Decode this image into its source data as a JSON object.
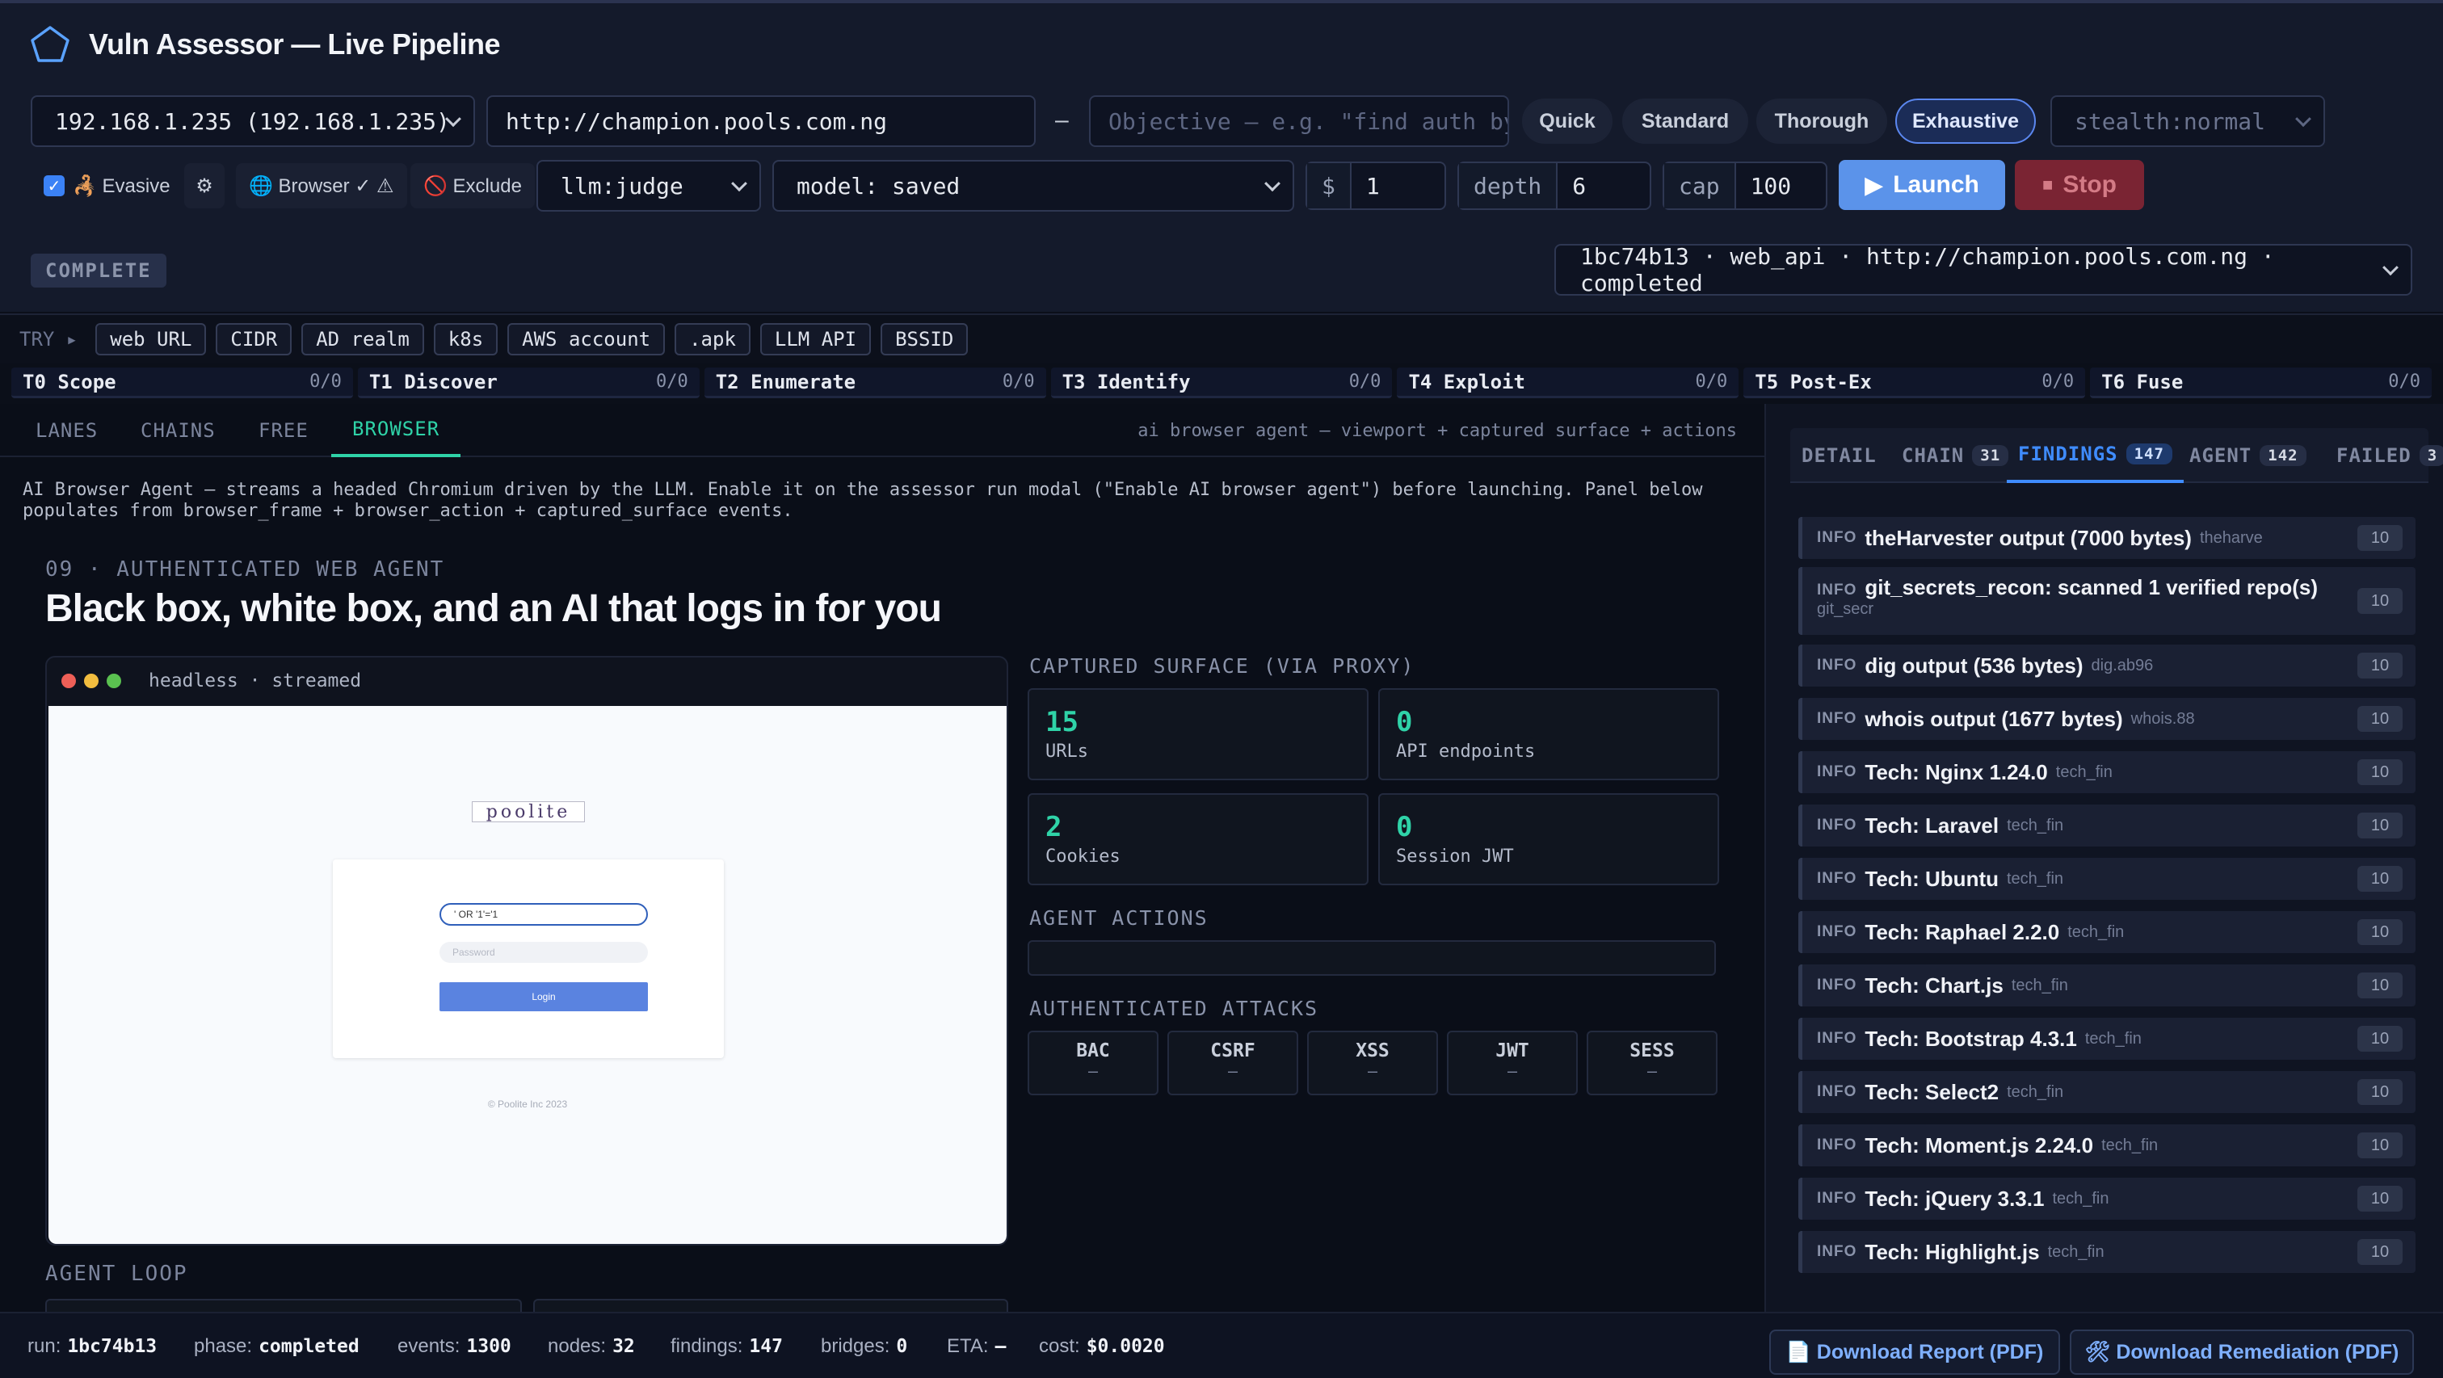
{
  "app": {
    "title": "Vuln Assessor — Live Pipeline",
    "logo_icon": "pentagon-icon"
  },
  "controls": {
    "target_select": "192.168.1.235 (192.168.1.235)",
    "target_url": "http://champion.pools.com.ng",
    "dash": "–",
    "objective_placeholder": "Objective — e.g. \"find auth by",
    "modes": [
      "Quick",
      "Standard",
      "Thorough",
      "Exhaustive"
    ],
    "active_mode": "Exhaustive",
    "stealth_select": "stealth:normal",
    "evasive_label": "🦂 Evasive",
    "evasive_checked": true,
    "gear_icon": "⚙",
    "browser_label": "🌐 Browser ✓ ⚠",
    "exclude_label": "🚫 Exclude",
    "llm_select": "llm:judge",
    "model_select": "model: saved",
    "budget_label": "$",
    "budget_value": "1",
    "depth_label": "depth",
    "depth_value": "6",
    "cap_label": "cap",
    "cap_value": "100",
    "launch_label": "Launch",
    "launch_icon": "▶",
    "stop_label": "Stop",
    "stop_icon": "■",
    "status": "COMPLETE",
    "run_select": "1bc74b13 · web_api · http://champion.pools.com.ng · completed"
  },
  "try": {
    "label": "TRY ▸",
    "chips": [
      "web URL",
      "CIDR",
      "AD realm",
      "k8s",
      "AWS account",
      ".apk",
      "LLM API",
      "BSSID"
    ]
  },
  "stages": [
    {
      "name": "T0 Scope",
      "count": "0/0"
    },
    {
      "name": "T1 Discover",
      "count": "0/0"
    },
    {
      "name": "T2 Enumerate",
      "count": "0/0"
    },
    {
      "name": "T3 Identify",
      "count": "0/0"
    },
    {
      "name": "T4 Exploit",
      "count": "0/0"
    },
    {
      "name": "T5 Post-Ex",
      "count": "0/0"
    },
    {
      "name": "T6 Fuse",
      "count": "0/0"
    }
  ],
  "main": {
    "tabs": [
      "LANES",
      "CHAINS",
      "FREE",
      "BROWSER"
    ],
    "active_tab": "BROWSER",
    "tab_hint": "ai browser agent — viewport + captured surface + actions",
    "description": "AI Browser Agent — streams a headed Chromium driven by the LLM. Enable it on the assessor run modal (\"Enable AI browser agent\") before launching. Panel below populates from browser_frame + browser_action + captured_surface events.",
    "section_tag": "09 · AUTHENTICATED WEB AGENT",
    "headline": "Black box, white box, and an AI that logs in for you",
    "viewport": {
      "caption": "headless · streamed",
      "logo_text": "poolite",
      "username_value": "' OR '1'='1",
      "password_placeholder": "Password",
      "login_button": "Login",
      "footer": "© Poolite Inc 2023"
    },
    "captured_title": "CAPTURED SURFACE (VIA PROXY)",
    "captured": [
      {
        "value": "15",
        "label": "URLs"
      },
      {
        "value": "0",
        "label": "API endpoints"
      },
      {
        "value": "2",
        "label": "Cookies"
      },
      {
        "value": "0",
        "label": "Session JWT"
      }
    ],
    "actions_title": "AGENT ACTIONS",
    "attacks_title": "AUTHENTICATED ATTACKS",
    "attacks": [
      {
        "name": "BAC",
        "value": "–"
      },
      {
        "name": "CSRF",
        "value": "–"
      },
      {
        "name": "XSS",
        "value": "–"
      },
      {
        "name": "JWT",
        "value": "–"
      },
      {
        "name": "SESS",
        "value": "–"
      }
    ],
    "agent_loop_title": "AGENT LOOP"
  },
  "right": {
    "tabs": [
      {
        "label": "DETAIL",
        "count": ""
      },
      {
        "label": "CHAIN",
        "count": "31"
      },
      {
        "label": "FINDINGS",
        "count": "147"
      },
      {
        "label": "AGENT",
        "count": "142"
      },
      {
        "label": "FAILED",
        "count": "3"
      }
    ],
    "active_tab": "FINDINGS",
    "findings": [
      {
        "sev": "INFO",
        "title": "theHarvester output (7000 bytes)",
        "src": "theharve",
        "score": "10"
      },
      {
        "sev": "INFO",
        "title": "git_secrets_recon: scanned 1 verified repo(s)",
        "src": "git_secr",
        "score": "10"
      },
      {
        "sev": "INFO",
        "title": "dig output (536 bytes)",
        "src": "dig.ab96",
        "score": "10"
      },
      {
        "sev": "INFO",
        "title": "whois output (1677 bytes)",
        "src": "whois.88",
        "score": "10"
      },
      {
        "sev": "INFO",
        "title": "Tech: Nginx 1.24.0",
        "src": "tech_fin",
        "score": "10"
      },
      {
        "sev": "INFO",
        "title": "Tech: Laravel",
        "src": "tech_fin",
        "score": "10"
      },
      {
        "sev": "INFO",
        "title": "Tech: Ubuntu",
        "src": "tech_fin",
        "score": "10"
      },
      {
        "sev": "INFO",
        "title": "Tech: Raphael 2.2.0",
        "src": "tech_fin",
        "score": "10"
      },
      {
        "sev": "INFO",
        "title": "Tech: Chart.js",
        "src": "tech_fin",
        "score": "10"
      },
      {
        "sev": "INFO",
        "title": "Tech: Bootstrap 4.3.1",
        "src": "tech_fin",
        "score": "10"
      },
      {
        "sev": "INFO",
        "title": "Tech: Select2",
        "src": "tech_fin",
        "score": "10"
      },
      {
        "sev": "INFO",
        "title": "Tech: Moment.js 2.24.0",
        "src": "tech_fin",
        "score": "10"
      },
      {
        "sev": "INFO",
        "title": "Tech: jQuery 3.3.1",
        "src": "tech_fin",
        "score": "10"
      },
      {
        "sev": "INFO",
        "title": "Tech: Highlight.js",
        "src": "tech_fin",
        "score": "10"
      }
    ]
  },
  "statusbar": {
    "items": [
      {
        "label": "run:",
        "value": "1bc74b13"
      },
      {
        "label": "phase:",
        "value": "completed"
      },
      {
        "label": "events:",
        "value": "1300"
      },
      {
        "label": "nodes:",
        "value": "32"
      },
      {
        "label": "findings:",
        "value": "147"
      },
      {
        "label": "bridges:",
        "value": "0"
      },
      {
        "label": "ETA:",
        "value": "—"
      },
      {
        "label": "cost:",
        "value": "$0.0020"
      }
    ],
    "download_report": "📄 Download Report (PDF)",
    "download_remediation": "🛠 Download Remediation (PDF)"
  },
  "colors": {
    "accent_green": "#2fd3a8",
    "accent_blue": "#3f8cff",
    "launch": "#5b93ea",
    "stop": "#7a2433"
  }
}
